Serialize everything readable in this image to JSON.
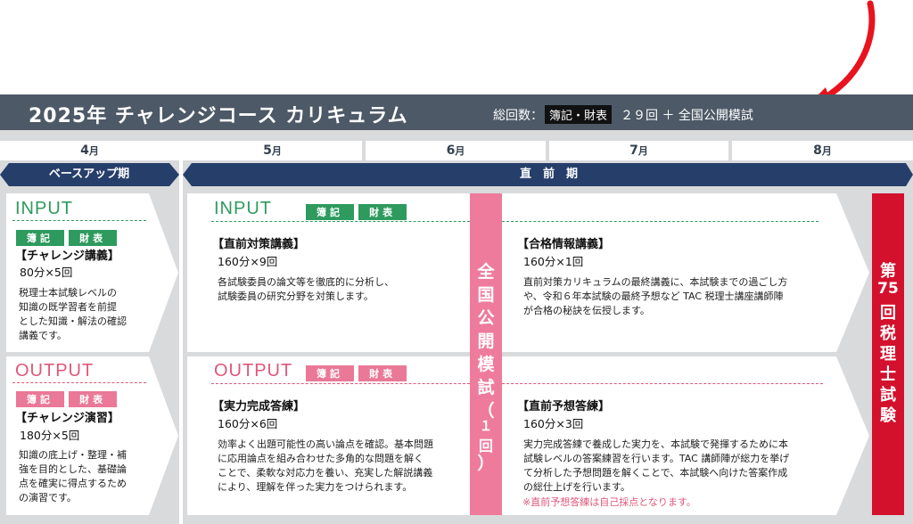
{
  "header": {
    "title": "2025年 チャレンジコース カリキュラム",
    "total_label": "総回数：",
    "total_tag": "簿記・財表",
    "total_value": "２９回 ＋ 全国公開模試"
  },
  "months": [
    "4",
    "5",
    "6",
    "7",
    "8"
  ],
  "month_unit": "月",
  "phases": {
    "base": "ベースアップ期",
    "direct": "直　前　期"
  },
  "tags": {
    "boki": "簿記",
    "zaihyo": "財表"
  },
  "left": {
    "input": {
      "heading": "INPUT",
      "course": "【チャレンジ講義】",
      "sessions": "80分×5回",
      "desc": [
        "税理士本試験レベルの",
        "知識の既学習者を前提",
        "とした知識・解法の確認",
        "講義です。"
      ]
    },
    "output": {
      "heading": "OUTPUT",
      "course": "【チャレンジ演習】",
      "sessions": "180分×5回",
      "desc": [
        "知識の底上げ・整理・補",
        "強を目的とした、基礎論",
        "点を確実に得点するため",
        "の演習です。"
      ]
    }
  },
  "right": {
    "input": {
      "heading": "INPUT",
      "c1_title": "【直前対策講義】",
      "c1_sessions": "160分×9回",
      "c1_desc": [
        "各試験委員の論文等を徹底的に分析し、",
        "試験委員の研究分野を対策します。"
      ],
      "c2_title": "【合格情報講義】",
      "c2_sessions": "160分×1回",
      "c2_desc": [
        "直前対策カリキュラムの最終講義に、本試験までの過ごし方",
        "や、令和６年本試験の最終予想など TAC 税理士講座講師陣",
        "が合格の秘訣を伝授します。"
      ]
    },
    "output": {
      "heading": "OUTPUT",
      "c1_title": "【実力完成答練】",
      "c1_sessions": "160分×6回",
      "c1_desc": [
        "効率よく出題可能性の高い論点を確認。基本問題",
        "に応用論点を組み合わせた多角的な問題を解く",
        "ことで、柔軟な対応力を養い、充実した解説講義",
        "により、理解を伴った実力をつけられます。"
      ],
      "c2_title": "【直前予想答練】",
      "c2_sessions": "160分×3回",
      "c2_desc": [
        "実力完成答練で養成した実力を、本試験で発揮するために本",
        "試験レベルの答案練習を行います。TAC 講師陣が総力を挙げ",
        "て分析した予想問題を解くことで、本試験へ向けた答案作成",
        "の総仕上げを行います。"
      ],
      "c2_note": "※直前予想答練は自己採点となります。"
    }
  },
  "mock_exam": {
    "chars": [
      "全",
      "国",
      "公",
      "開",
      "模",
      "試",
      "（",
      "１",
      "回",
      "）"
    ]
  },
  "final_exam": {
    "chars": [
      "第",
      "75",
      "回",
      "税",
      "理",
      "士",
      "試",
      "験"
    ]
  },
  "colors": {
    "navy": "#263f6a",
    "green": "#2e9a5e",
    "pink": "#ea7897",
    "red": "#d3112d",
    "header": "#4d5966"
  }
}
